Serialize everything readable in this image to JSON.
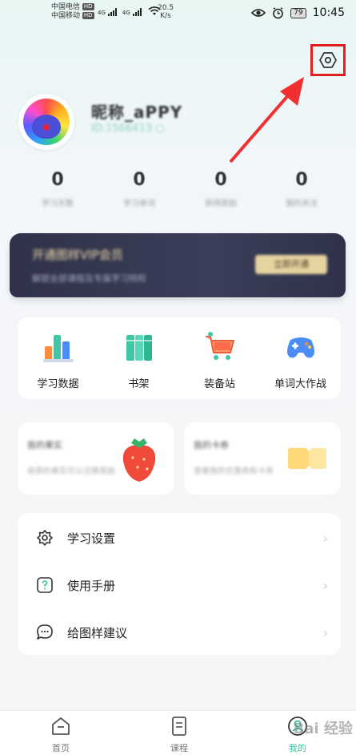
{
  "status_bar": {
    "carrier1": "中国电信",
    "carrier2": "中国移动",
    "hd": "HD",
    "net1": "4G",
    "net2": "4G",
    "speed": "20.5",
    "speed_unit": "K/s",
    "battery": "79",
    "time": "10:45"
  },
  "profile": {
    "username": "昵称_aPPY",
    "user_id": "ID:1566413 ○"
  },
  "stats": [
    {
      "value": "0",
      "label": "学习天数"
    },
    {
      "value": "0",
      "label": "学习单词"
    },
    {
      "value": "0",
      "label": "获得奖励"
    },
    {
      "value": "0",
      "label": "我的关注"
    }
  ],
  "banner": {
    "title": "开通图样VIP会员",
    "subtitle": "解锁全部课程及专属学习特权",
    "button": "立即开通"
  },
  "features": [
    {
      "label": "学习数据",
      "icon": "bar-chart-icon"
    },
    {
      "label": "书架",
      "icon": "books-icon"
    },
    {
      "label": "装备站",
      "icon": "shopping-cart-icon"
    },
    {
      "label": "单词大作战",
      "icon": "gamepad-icon"
    }
  ],
  "promo_cards": [
    {
      "title": "我的果实",
      "subtitle": "收获的果实可以兑换奖励"
    },
    {
      "title": "我的卡券",
      "subtitle": "查看我的优惠券和卡券"
    }
  ],
  "menu": [
    {
      "label": "学习设置",
      "icon": "settings-icon"
    },
    {
      "label": "使用手册",
      "icon": "help-icon"
    },
    {
      "label": "给图样建议",
      "icon": "feedback-icon"
    }
  ],
  "nav": [
    {
      "label": "首页",
      "icon": "home-icon"
    },
    {
      "label": "课程",
      "icon": "course-icon"
    },
    {
      "label": "我的",
      "icon": "profile-icon"
    }
  ],
  "watermark": "Bai 经验",
  "colors": {
    "accent": "#36c2a0",
    "highlight": "#e02020",
    "banner": "#2f3249"
  }
}
